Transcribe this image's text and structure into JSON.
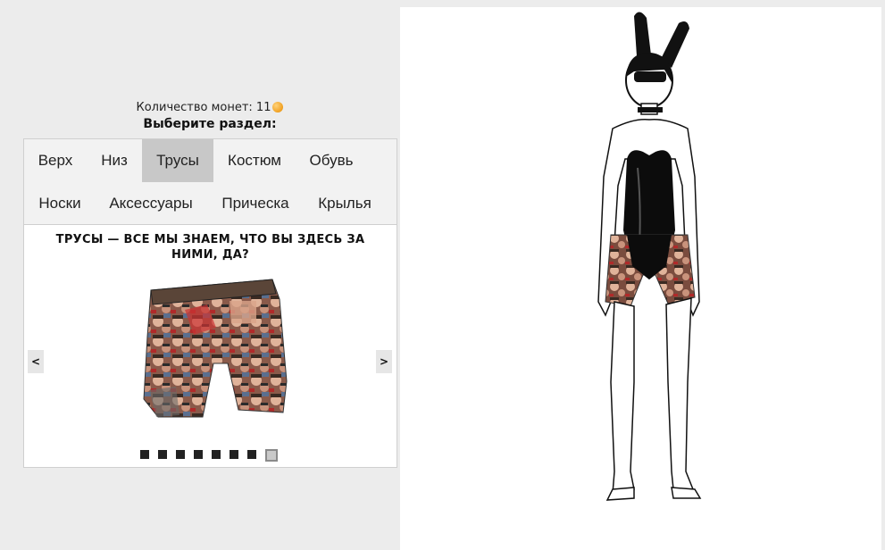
{
  "header": {
    "coins_label": "Количество монет: 11",
    "choose_section": "Выберите раздел:"
  },
  "tabs": [
    {
      "label": "Верх",
      "active": false
    },
    {
      "label": "Низ",
      "active": false
    },
    {
      "label": "Трусы",
      "active": true
    },
    {
      "label": "Костюм",
      "active": false
    },
    {
      "label": "Обувь",
      "active": false
    },
    {
      "label": "Носки",
      "active": false
    },
    {
      "label": "Аксессуары",
      "active": false
    },
    {
      "label": "Прическа",
      "active": false
    },
    {
      "label": "Крылья",
      "active": false
    }
  ],
  "panel": {
    "title": "ТРУСЫ — ВСЕ МЫ ЗНАЕМ, ЧТО ВЫ ЗДЕСЬ ЗА НИМИ, ДА?",
    "prev_label": "<",
    "next_label": ">",
    "item_count": 8,
    "selected_index": 7
  },
  "colors": {
    "background": "#ececec",
    "tab_active": "#c8c8c8",
    "coin": "#f0a020"
  },
  "icons": {
    "coin": "coin-icon"
  }
}
